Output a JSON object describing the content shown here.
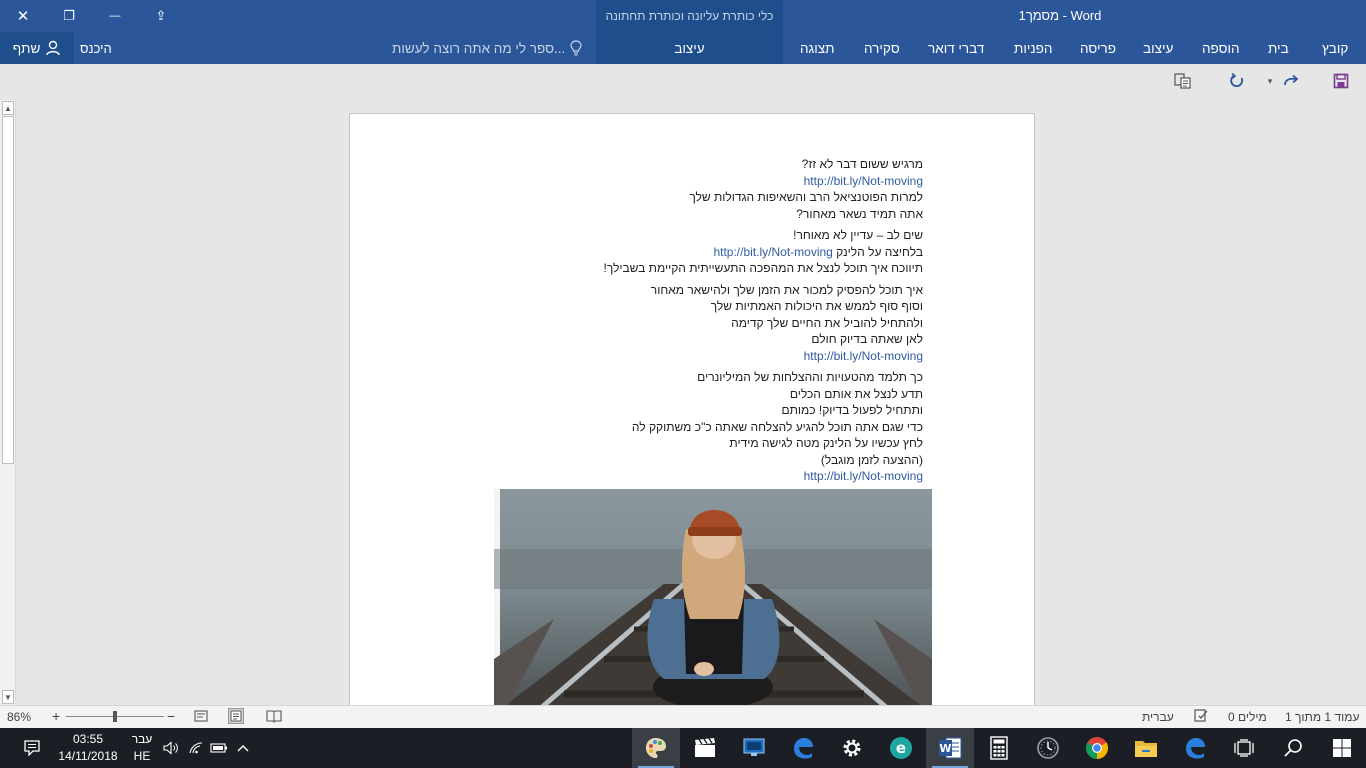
{
  "window": {
    "title": "מסמך1 - Word",
    "context_group_title": "כלי כותרת עליונה וכותרת תחתונה",
    "context_tab": "עיצוב",
    "close_glyph": "✕",
    "restore_glyph": "❐",
    "minimize_glyph": "—",
    "ribbon_display_glyph": "⇪"
  },
  "ribbon": {
    "tabs": [
      "קובץ",
      "בית",
      "הוספה",
      "עיצוב",
      "פריסה",
      "הפניות",
      "דברי דואר",
      "סקירה",
      "תצוגה"
    ],
    "tell_me_placeholder": "ספר לי מה אתה רוצה לעשות...",
    "sign_in": "היכנס",
    "share": "שתף"
  },
  "document": {
    "lines": [
      {
        "text": "מרגיש ששום דבר לא זז?",
        "link": false,
        "gap_before": false
      },
      {
        "text": "http://bit.ly/Not-moving",
        "link": true,
        "gap_before": false
      },
      {
        "text": "למרות הפוטנציאל הרב והשאיפות הגדולות שלך",
        "link": false,
        "gap_before": false
      },
      {
        "text": "אתה תמיד נשאר מאחור?",
        "link": false,
        "gap_before": false
      },
      {
        "text": "שים לב – עדיין לא מאוחר!",
        "link": false,
        "gap_before": true
      },
      {
        "text": "בלחיצה על הלינק http://bit.ly/Not-moving",
        "link": false,
        "gap_before": false
      },
      {
        "text": "תיווכח איך תוכל לנצל את המהפכה התעשייתית הקיימת בשבילך!",
        "link": false,
        "gap_before": false
      },
      {
        "text": "איך תוכל להפסיק למכור את הזמן שלך ולהישאר מאחור",
        "link": false,
        "gap_before": true
      },
      {
        "text": "וסוף סוף לממש את היכולות האמתיות שלך",
        "link": false,
        "gap_before": false
      },
      {
        "text": "ולהתחיל להוביל את החיים שלך קדימה",
        "link": false,
        "gap_before": false
      },
      {
        "text": "לאן שאתה בדיוק חולם",
        "link": false,
        "gap_before": false
      },
      {
        "text": "http://bit.ly/Not-moving",
        "link": true,
        "gap_before": false
      },
      {
        "text": "כך תלמד מהטעויות וההצלחות של המיליונרים",
        "link": false,
        "gap_before": true
      },
      {
        "text": "תדע לנצל את אותם הכלים",
        "link": false,
        "gap_before": false
      },
      {
        "text": "ותתחיל לפעול בדיוק! כמותם",
        "link": false,
        "gap_before": false
      },
      {
        "text": "כדי שגם אתה תוכל להגיע להצלחה שאתה כ\"כ משתוקק לה",
        "link": false,
        "gap_before": false
      },
      {
        "text": "לחץ עכשיו על הלינק מטה לגישה מידית",
        "link": false,
        "gap_before": false
      },
      {
        "text": "(ההצעה לזמן מוגבל)",
        "link": false,
        "gap_before": false
      },
      {
        "text": "http://bit.ly/Not-moving",
        "link": true,
        "gap_before": false
      }
    ]
  },
  "statusbar": {
    "page": "עמוד 1 מתוך 1",
    "words": "0 מילים",
    "language": "עברית",
    "zoom": "86%",
    "zoom_fraction": 0.5,
    "zoom_in": "+",
    "zoom_out": "−"
  },
  "taskbar": {
    "time": "03:55",
    "date": "14/11/2018",
    "lang_top": "עבר",
    "lang_bottom": "HE",
    "apps": [
      "paint",
      "video",
      "remote-desktop",
      "edge",
      "settings",
      "edge-e",
      "word",
      "calculator",
      "clock",
      "chrome",
      "file-explorer",
      "edge",
      "task-view",
      "search",
      "start"
    ]
  },
  "colors": {
    "ribbon_blue": "#2b579a",
    "context_blue": "#1e4e8c",
    "link_blue": "#2e5c9e",
    "taskbar": "#1b1f25"
  }
}
